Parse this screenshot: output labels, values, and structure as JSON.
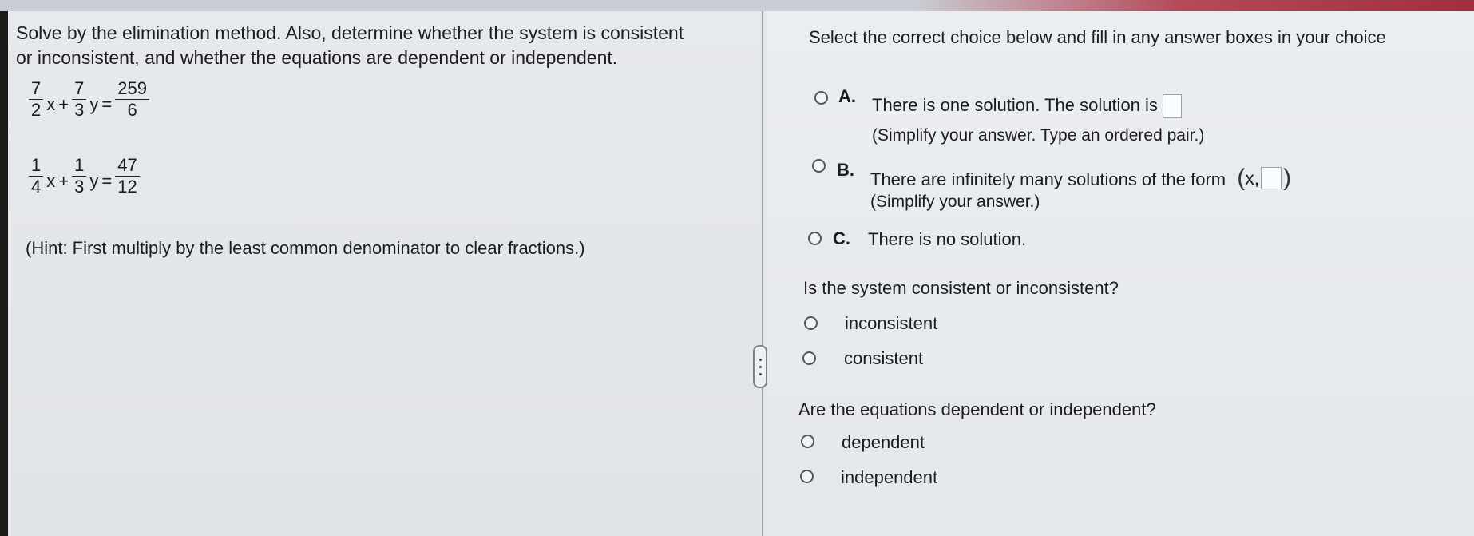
{
  "problem": {
    "instructions_line1": "Solve by the elimination method. Also, determine whether the system is consistent",
    "instructions_line2": "or inconsistent, and whether the equations are dependent or independent.",
    "eq1": {
      "a_num": "7",
      "a_den": "2",
      "x": "x",
      "plus": "+",
      "b_num": "7",
      "b_den": "3",
      "y": "y",
      "eq": "=",
      "c_num": "259",
      "c_den": "6"
    },
    "eq2": {
      "a_num": "1",
      "a_den": "4",
      "x": "x",
      "plus": "+",
      "b_num": "1",
      "b_den": "3",
      "y": "y",
      "eq": "=",
      "c_num": "47",
      "c_den": "12"
    },
    "hint": "(Hint: First multiply by the least common denominator to clear fractions.)"
  },
  "answer": {
    "prompt": "Select the correct choice below and fill in any answer boxes in your choice",
    "options": [
      {
        "letter": "A.",
        "text": "There is one solution. The solution is",
        "note": "(Simplify your answer. Type an ordered pair.)"
      },
      {
        "letter": "B.",
        "text": "There are infinitely many solutions of the form",
        "pair_left": "(",
        "pair_var": "x,",
        "pair_right": ")",
        "note": "(Simplify your answer.)"
      },
      {
        "letter": "C.",
        "text": "There is no solution."
      }
    ],
    "consistency": {
      "question": "Is the system consistent or inconsistent?",
      "choices": [
        "inconsistent",
        "consistent"
      ]
    },
    "dependence": {
      "question": "Are the equations dependent or independent?",
      "choices": [
        "dependent",
        "independent"
      ]
    }
  },
  "colors": {
    "accent_bar": "#b54a5a",
    "radio_border": "#4d5863",
    "divider": "#9ea3a9"
  }
}
